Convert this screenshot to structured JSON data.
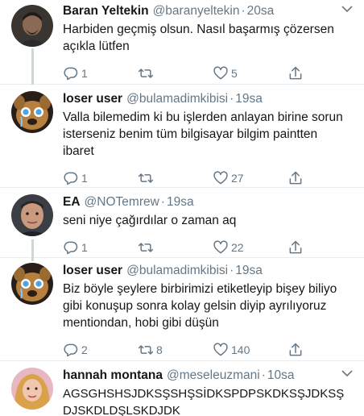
{
  "tweets": [
    {
      "name": "Baran Yeltekin",
      "handle": "@baranyeltekin",
      "time": "20sa",
      "text": "Harbiden geçmiş olsun. Nasıl başarmış çözersen açıkla lütfen",
      "replies": "1",
      "retweets": "",
      "likes": "5"
    },
    {
      "name": "loser user",
      "handle": "@bulamadimkibisi",
      "time": "19sa",
      "text": "Valla bilemedim ki bu işlerden anlayan birine sorun isterseniz benim tüm bilgisayar bilgim paintten ibaret",
      "replies": "1",
      "retweets": "",
      "likes": "27"
    },
    {
      "name": "EA",
      "handle": "@NOTemrew",
      "time": "19sa",
      "text": "seni niye çağırdılar o zaman aq",
      "replies": "1",
      "retweets": "",
      "likes": "22"
    },
    {
      "name": "loser user",
      "handle": "@bulamadimkibisi",
      "time": "19sa",
      "text": "Biz böyle şeylere birbirimizi etiketleyip bişey biliyo gibi konuşup sonra kolay gelsin diyip ayrılıyoruz mentiondan, hobi gibi düşün",
      "replies": "2",
      "retweets": "8",
      "likes": "140"
    },
    {
      "name": "hannah montana",
      "handle": "@meseleuzmani",
      "time": "10sa",
      "text": "AGSGHSHSJDKSŞSHŞSİDKSPDPSKDKSŞJDKSŞ DJSKDLDŞLSKDJDK",
      "replies": "",
      "retweets": "",
      "likes": ""
    }
  ],
  "separator": "·",
  "colors": {
    "text": "#14171a",
    "secondary": "#657786",
    "divider": "#e6ecf0",
    "thread_line": "#ccd6dd"
  },
  "icons": {
    "reply": "reply-icon",
    "retweet": "retweet-icon",
    "like": "heart-icon",
    "share": "share-icon",
    "menu": "chevron-down-icon"
  }
}
